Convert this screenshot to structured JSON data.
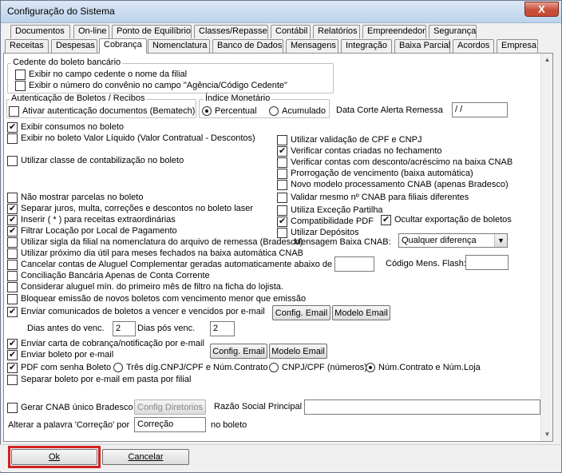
{
  "window": {
    "title": "Configuração do Sistema",
    "close_glyph": "X"
  },
  "tabs_row1": [
    "Documentos",
    "On-line",
    "Ponto de Equilíbrio",
    "Classes/Repasse",
    "Contábil",
    "Relatórios",
    "Empreendedor",
    "Segurança"
  ],
  "tabs_row2": [
    "Receitas",
    "Despesas",
    "Cobrança",
    "Nomenclatura",
    "Banco de Dados",
    "Mensagens",
    "Integração",
    "Baixa Parcial",
    "Acordos",
    "Empresa"
  ],
  "active_tab": "Cobrança",
  "cedente": {
    "title": "Cedente do boleto bancário",
    "opt1": "Exibir no campo cedente o nome da filial",
    "opt2": "Exibir o número do convênio no campo \"Agência/Código Cedente\""
  },
  "autenticacao": {
    "title": "Autenticação de Boletos / Recibos",
    "opt": "Ativar autenticação documentos (Bematech)"
  },
  "indice": {
    "title": "Índice Monetário",
    "percentual": "Percentual",
    "acumulado": "Acumulado"
  },
  "data_corte": {
    "label": "Data Corte Alerta Remessa",
    "value": " /  /"
  },
  "left": {
    "exibir_consumos": "Exibir consumos no boleto",
    "exibir_liquido": "Exibir no boleto Valor Líquido (Valor Contratual - Descontos)",
    "classe_contab": "Utilizar classe de contabilização no boleto",
    "nao_parcelas": "Não mostrar parcelas no boleto",
    "separar_juros": "Separar juros, multa, correções e descontos no boleto laser",
    "inserir_receitas": "Inserir ( * ) para receitas extraordinárias",
    "filtrar_locacao": "Filtrar Locação por Local de Pagamento",
    "sigla_filial": "Utilizar sigla da filial na nomenclatura do arquivo de remessa (Bradesco)",
    "proximo_dia": "Utilizar próximo dia útil para meses fechados na baixa automática CNAB",
    "cancelar_aluguel": "Cancelar contas de Aluguel Complementar geradas automaticamente abaixo de R$",
    "conciliacao": "Conciliação Bancária Apenas de Conta Corrente",
    "aluguel_min": "Considerar aluguel mín. do primeiro mês de filtro na ficha do lojista.",
    "bloquear": "Bloquear emissão de novos boletos com vencimento menor que emissão",
    "enviar_comunicados": "Enviar comunicados de boletos a vencer e vencidos por e-mail",
    "dias_antes": "Dias antes do venc.",
    "dias_antes_val": "2",
    "dias_pos": "Dias pós venc.",
    "dias_pos_val": "2",
    "carta_cobranca": "Enviar carta de cobrança/notificação por e-mail",
    "boleto_email": "Enviar boleto por e-mail",
    "pdf_senha": "PDF com senha Boleto",
    "separar_email": "Separar boleto por e-mail em pasta por filial",
    "gerar_cnab": "Gerar CNAB único Bradesco",
    "alterar_palavra": "Alterar a palavra 'Correção' por",
    "alterar_val": "Correção",
    "no_boleto": "no boleto"
  },
  "pdf_options": {
    "tres_dig": "Três díg.CNPJ/CPF e Núm.Contrato",
    "cnpj_num": "CNPJ/CPF (números)",
    "num_loja": "Núm.Contrato e Núm.Loja"
  },
  "right": {
    "validacao_cpf": "Utilizar validação de CPF e CNPJ",
    "verificar_contas": "Verificar contas criadas no fechamento",
    "verificar_desconto": "Verificar contas com desconto/acréscimo na baixa CNAB",
    "prorrogacao": "Prorrogação de vencimento (baixa automática)",
    "novo_modelo": "Novo modelo processamento CNAB (apenas Bradesco)",
    "validar_cnab": "Validar mesmo nº CNAB para filiais diferentes",
    "excecao": "Utiliza Exceção Partilha",
    "compat_pdf": "Compatibilidade PDF",
    "ocultar": "Ocultar exportação de boletos",
    "depositos": "Utilizar Depósitos",
    "msg_baixa": "Mensagem Baixa CNAB:",
    "msg_baixa_val": "Qualquer diferença",
    "codigo_flash": "Código Mens. Flash:",
    "razao_social": "Razão Social Principal"
  },
  "buttons": {
    "config_email": "Config. Email",
    "modelo_email": "Modelo Email",
    "config_diretorios": "Config Diretorios",
    "ok": "Ok",
    "cancelar": "Cancelar"
  }
}
